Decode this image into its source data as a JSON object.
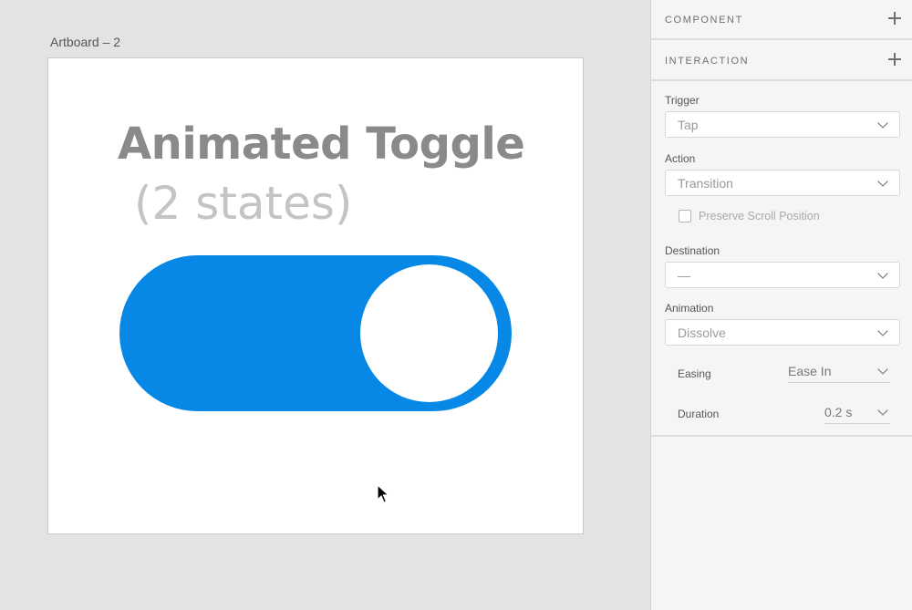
{
  "artboard": {
    "label": "Artboard – 2",
    "title": "Animated Toggle",
    "subtitle": "(2 states)",
    "toggle_color": "#0787e6",
    "toggle_state": "on"
  },
  "panel": {
    "component": {
      "title": "COMPONENT"
    },
    "interaction": {
      "title": "INTERACTION",
      "trigger": {
        "label": "Trigger",
        "value": "Tap"
      },
      "action": {
        "label": "Action",
        "value": "Transition"
      },
      "preserve_scroll": {
        "label": "Preserve Scroll Position",
        "checked": false
      },
      "destination": {
        "label": "Destination",
        "value": "—"
      },
      "animation": {
        "label": "Animation",
        "value": "Dissolve"
      },
      "easing": {
        "label": "Easing",
        "value": "Ease In"
      },
      "duration": {
        "label": "Duration",
        "value": "0.2 s"
      }
    }
  }
}
